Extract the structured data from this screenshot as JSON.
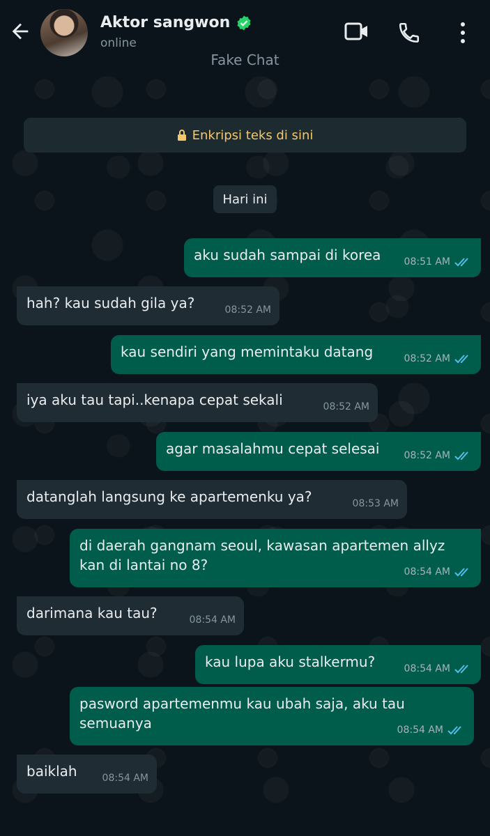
{
  "header": {
    "contact_name": "Aktor sangwon",
    "status": "online",
    "overlay_text": "Fake Chat",
    "icons": [
      "back-arrow-icon",
      "verified-badge-icon",
      "video-call-icon",
      "phone-call-icon",
      "more-options-icon"
    ],
    "verified_color": "#25d366"
  },
  "notice": {
    "encryption_text": "Enkripsi teks di sini",
    "date_label": "Hari ini"
  },
  "colors": {
    "background": "#0b141a",
    "outgoing_bubble": "#005c4b",
    "incoming_bubble": "#1f2c33",
    "read_tick": "#53bdeb",
    "notice_text": "#f4c86b"
  },
  "messages": [
    {
      "direction": "out",
      "text": "aku sudah sampai di korea",
      "time": "08:51 AM",
      "status": "read"
    },
    {
      "direction": "in",
      "text": "hah? kau sudah gila ya?",
      "time": "08:52 AM"
    },
    {
      "direction": "out",
      "text": "kau sendiri yang memintaku datang",
      "time": "08:52 AM",
      "status": "read"
    },
    {
      "direction": "in",
      "text": "iya aku tau tapi..kenapa cepat sekali",
      "time": "08:52 AM"
    },
    {
      "direction": "out",
      "text": "agar masalahmu cepat selesai",
      "time": "08:52 AM",
      "status": "read"
    },
    {
      "direction": "in",
      "text": "datanglah langsung ke apartemenku ya?",
      "time": "08:53 AM"
    },
    {
      "direction": "out",
      "text": "di daerah gangnam seoul, kawasan apartemen allyz kan di lantai no 8?",
      "time": "08:54 AM",
      "status": "read"
    },
    {
      "direction": "in",
      "text": "darimana kau tau?",
      "time": "08:54 AM"
    },
    {
      "direction": "out",
      "text": "kau lupa aku stalkermu?",
      "time": "08:54 AM",
      "status": "read"
    },
    {
      "direction": "out",
      "text": "pasword apartemenmu kau ubah saja, aku tau semuanya",
      "time": "08:54 AM",
      "status": "read"
    },
    {
      "direction": "in",
      "text": "baiklah",
      "time": "08:54 AM"
    }
  ]
}
